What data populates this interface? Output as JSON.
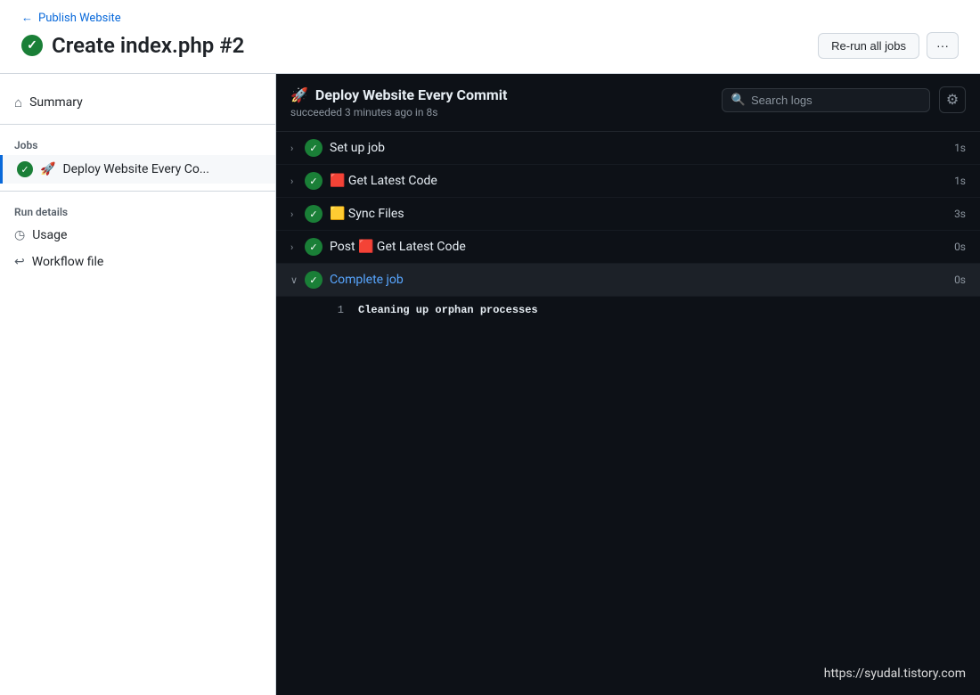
{
  "header": {
    "back_label": "Publish Website",
    "title": "Create index.php #2",
    "rerun_label": "Re-run all jobs",
    "more_label": "···"
  },
  "sidebar": {
    "summary_label": "Summary",
    "jobs_section": "Jobs",
    "active_job": "Deploy Website Every Co...",
    "run_details_section": "Run details",
    "usage_label": "Usage",
    "workflow_file_label": "Workflow file"
  },
  "log_panel": {
    "title": "Deploy Website Every Commit",
    "subtitle": "succeeded 3 minutes ago in 8s",
    "search_placeholder": "Search logs",
    "steps": [
      {
        "name": "Set up job",
        "duration": "1s",
        "expanded": false,
        "icon": "✓"
      },
      {
        "name": "🟥 Get Latest Code",
        "duration": "1s",
        "expanded": false,
        "icon": "✓"
      },
      {
        "name": "🟨 Sync Files",
        "duration": "3s",
        "expanded": false,
        "icon": "✓"
      },
      {
        "name": "Post 🟥 Get Latest Code",
        "duration": "0s",
        "expanded": false,
        "icon": "✓"
      },
      {
        "name": "Complete job",
        "duration": "0s",
        "expanded": true,
        "icon": "✓"
      }
    ],
    "log_lines": [
      {
        "num": "1",
        "text": "Cleaning up orphan processes"
      }
    ]
  },
  "watermark": "https://syudal.tistory.com"
}
